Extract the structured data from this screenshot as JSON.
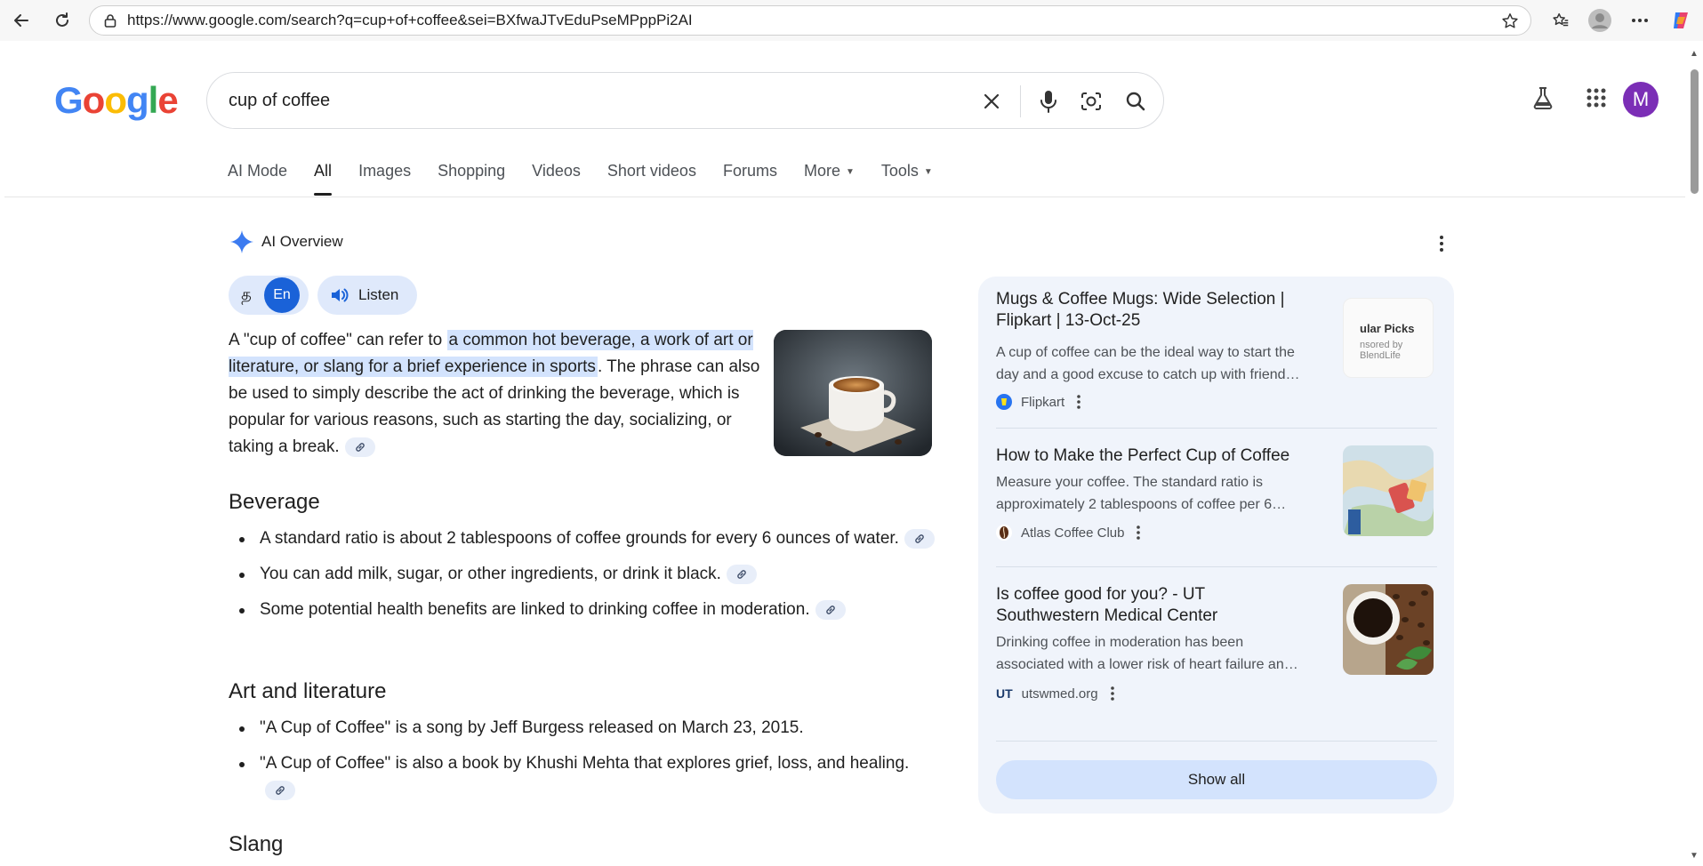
{
  "browser": {
    "url": "https://www.google.com/search?q=cup+of+coffee&sei=BXfwaJTvEduPseMPppPi2AI"
  },
  "header": {
    "logo_letters": [
      "G",
      "o",
      "o",
      "g",
      "l",
      "e"
    ],
    "query": "cup of coffee",
    "avatar_initial": "M"
  },
  "tabs": [
    {
      "label": "AI Mode",
      "active": false
    },
    {
      "label": "All",
      "active": true
    },
    {
      "label": "Images",
      "active": false
    },
    {
      "label": "Shopping",
      "active": false
    },
    {
      "label": "Videos",
      "active": false
    },
    {
      "label": "Short videos",
      "active": false
    },
    {
      "label": "Forums",
      "active": false
    },
    {
      "label": "More",
      "active": false
    },
    {
      "label": "Tools",
      "active": false
    }
  ],
  "ai_overview": {
    "title": "AI Overview",
    "lang_ta": "த",
    "lang_en": "En",
    "listen": "Listen",
    "intro_pre": "A \"cup of coffee\" can refer to ",
    "intro_highlight": "a common hot beverage, a work of art or literature, or slang for a brief experience in sports",
    "intro_post": ". The phrase can also be used to simply describe the act of drinking the beverage, which is popular for various reasons, such as starting the day, socializing, or taking a break.",
    "sections": [
      {
        "heading": "Beverage",
        "items": [
          "A standard ratio is about 2 tablespoons of coffee grounds for every 6 ounces of water.",
          "You can add milk, sugar, or other ingredients, or drink it black.",
          "Some potential health benefits are linked to drinking coffee in moderation."
        ]
      },
      {
        "heading": "Art and literature",
        "items": [
          "\"A Cup of Coffee\" is a song by Jeff Burgess released on March 23, 2015.",
          "\"A Cup of Coffee\" is also a book by Khushi Mehta that explores grief, loss, and healing."
        ]
      },
      {
        "heading": "Slang",
        "items": []
      }
    ]
  },
  "sources": [
    {
      "title": "Mugs & Coffee Mugs: Wide Selection | Flipkart | 13-Oct-25",
      "snippet_1": "A cup of coffee can be the ideal way to start the",
      "snippet_2": "day and a good excuse to catch up with friend…",
      "source": "Flipkart",
      "thumb_text_1": "ular Picks",
      "thumb_text_2": "nsored by BlendLife"
    },
    {
      "title": "How to Make the Perfect Cup of Coffee",
      "snippet_1": "Measure your coffee. The standard ratio is",
      "snippet_2": "approximately 2 tablespoons of coffee per 6…",
      "source": "Atlas Coffee Club"
    },
    {
      "title": "Is coffee good for you? - UT Southwestern Medical Center",
      "snippet_1": "Drinking coffee in moderation has been",
      "snippet_2": "associated with a lower risk of heart failure an…",
      "source": "utswmed.org",
      "fav_text": "UT"
    }
  ],
  "show_all": "Show all",
  "colors": {
    "accent": "#1a62d8",
    "highlight": "#d3e3fd",
    "panel": "#f0f4fb",
    "avatar": "#7b2eb6"
  }
}
